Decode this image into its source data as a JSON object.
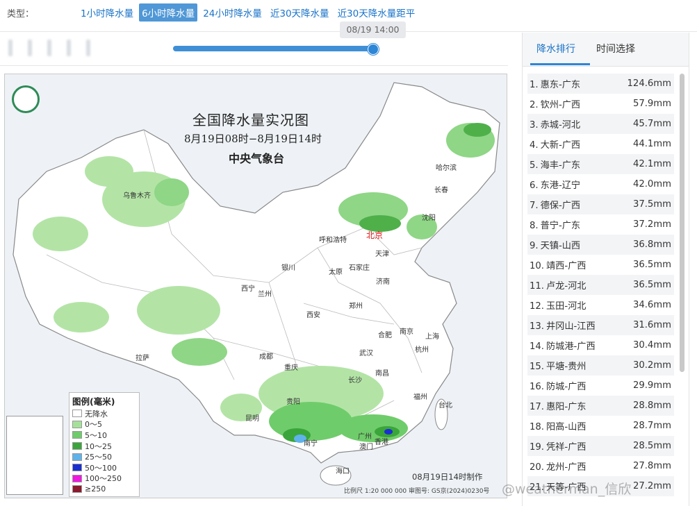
{
  "header": {
    "type_label": "类型：",
    "tabs": [
      {
        "label": "1小时降水量",
        "active": false
      },
      {
        "label": "6小时降水量",
        "active": true
      },
      {
        "label": "24小时降水量",
        "active": false
      },
      {
        "label": "近30天降水量",
        "active": false
      },
      {
        "label": "近30天降水量距平",
        "active": false
      }
    ]
  },
  "timeline": {
    "current_time": "08/19 14:00",
    "progress": 1.0
  },
  "map": {
    "title": "全国降水量实况图",
    "date_range": "8月19日08时−8月19日14时",
    "agency": "中央气象台",
    "made_at": "08月19日14时制作",
    "scale_text": "比例尺 1:20 000 000    审图号: GS京(2024)0230号",
    "cities": [
      {
        "name": "乌鲁木齐"
      },
      {
        "name": "哈尔滨"
      },
      {
        "name": "长春"
      },
      {
        "name": "沈阳"
      },
      {
        "name": "呼和浩特"
      },
      {
        "name": "北京"
      },
      {
        "name": "天津"
      },
      {
        "name": "银川"
      },
      {
        "name": "太原"
      },
      {
        "name": "石家庄"
      },
      {
        "name": "西宁"
      },
      {
        "name": "兰州"
      },
      {
        "name": "济南"
      },
      {
        "name": "郑州"
      },
      {
        "name": "西安"
      },
      {
        "name": "合肥"
      },
      {
        "name": "南京"
      },
      {
        "name": "上海"
      },
      {
        "name": "拉萨"
      },
      {
        "name": "成都"
      },
      {
        "name": "武汉"
      },
      {
        "name": "杭州"
      },
      {
        "name": "重庆"
      },
      {
        "name": "南昌"
      },
      {
        "name": "长沙"
      },
      {
        "name": "福州"
      },
      {
        "name": "贵阳"
      },
      {
        "name": "台北"
      },
      {
        "name": "昆明"
      },
      {
        "name": "南宁"
      },
      {
        "name": "广州"
      },
      {
        "name": "香港"
      },
      {
        "name": "澳门"
      },
      {
        "name": "海口"
      }
    ],
    "legend": {
      "title": "图例(毫米)",
      "items": [
        {
          "label": "无降水",
          "color": "#ffffff"
        },
        {
          "label": "0～5",
          "color": "#a6e19a"
        },
        {
          "label": "5～10",
          "color": "#6fcc6a"
        },
        {
          "label": "10～25",
          "color": "#3aa53a"
        },
        {
          "label": "25～50",
          "color": "#5fb3ea"
        },
        {
          "label": "50～100",
          "color": "#1a2fd0"
        },
        {
          "label": "100～250",
          "color": "#f018e0"
        },
        {
          "label": "≥250",
          "color": "#8a1a2e"
        }
      ]
    }
  },
  "panel": {
    "tabs": [
      {
        "label": "降水排行",
        "active": true
      },
      {
        "label": "时间选择",
        "active": false
      }
    ],
    "ranking": [
      {
        "rank": "1.",
        "station": "惠东-广东",
        "value": "124.6mm"
      },
      {
        "rank": "2.",
        "station": "钦州-广西",
        "value": "57.9mm"
      },
      {
        "rank": "3.",
        "station": "赤城-河北",
        "value": "45.7mm"
      },
      {
        "rank": "4.",
        "station": "大新-广西",
        "value": "44.1mm"
      },
      {
        "rank": "5.",
        "station": "海丰-广东",
        "value": "42.1mm"
      },
      {
        "rank": "6.",
        "station": "东港-辽宁",
        "value": "42.0mm"
      },
      {
        "rank": "7.",
        "station": "德保-广西",
        "value": "37.5mm"
      },
      {
        "rank": "8.",
        "station": "普宁-广东",
        "value": "37.2mm"
      },
      {
        "rank": "9.",
        "station": "天镇-山西",
        "value": "36.8mm"
      },
      {
        "rank": "10.",
        "station": "靖西-广西",
        "value": "36.5mm"
      },
      {
        "rank": "11.",
        "station": "卢龙-河北",
        "value": "36.5mm"
      },
      {
        "rank": "12.",
        "station": "玉田-河北",
        "value": "34.6mm"
      },
      {
        "rank": "13.",
        "station": "井冈山-江西",
        "value": "31.6mm"
      },
      {
        "rank": "14.",
        "station": "防城港-广西",
        "value": "30.4mm"
      },
      {
        "rank": "15.",
        "station": "平塘-贵州",
        "value": "30.2mm"
      },
      {
        "rank": "16.",
        "station": "防城-广西",
        "value": "29.9mm"
      },
      {
        "rank": "17.",
        "station": "惠阳-广东",
        "value": "28.8mm"
      },
      {
        "rank": "18.",
        "station": "阳高-山西",
        "value": "28.7mm"
      },
      {
        "rank": "19.",
        "station": "凭祥-广西",
        "value": "28.5mm"
      },
      {
        "rank": "20.",
        "station": "龙州-广西",
        "value": "27.8mm"
      },
      {
        "rank": "21.",
        "station": "天等-广西",
        "value": "27.2mm"
      }
    ]
  },
  "watermark": "@weatherman_信欣"
}
